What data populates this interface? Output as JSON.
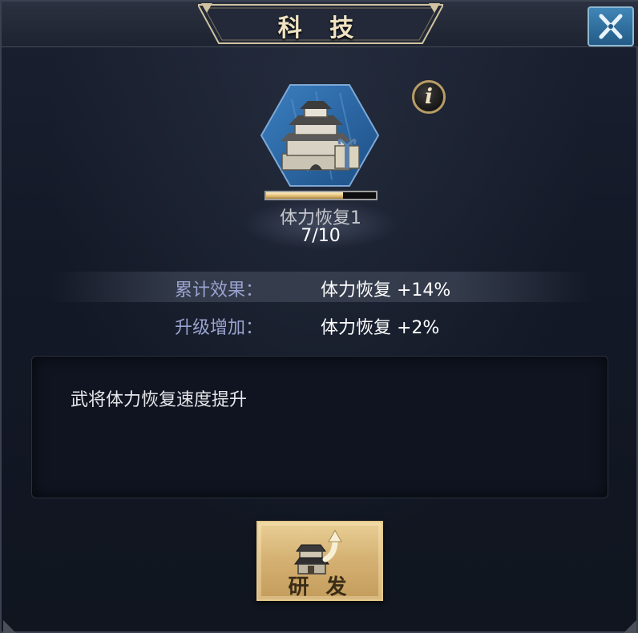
{
  "header": {
    "title": "科 技",
    "close_icon": "close-x-icon",
    "colors": {
      "close_bg": "#3f86b8",
      "title_text": "#efe3c2"
    }
  },
  "tech": {
    "icon": "fortress-gift-icon",
    "name": "体力恢复1",
    "level_text": "7/10",
    "progress": 0.7,
    "info_glyph": "i"
  },
  "effects": {
    "cumulative": {
      "label": "累计效果：",
      "value": "体力恢复 +14%"
    },
    "upgrade": {
      "label": "升级增加：",
      "value": "体力恢复 +2%"
    },
    "colors": {
      "label": "#9aa3cf",
      "value": "#ffffff"
    }
  },
  "description": {
    "text": "武将体力恢复速度提升"
  },
  "research_button": {
    "label": "研 发",
    "icon": "building-upgrade-arrow-icon",
    "colors": {
      "bg": "#d4b072",
      "text": "#3a2c16"
    }
  }
}
